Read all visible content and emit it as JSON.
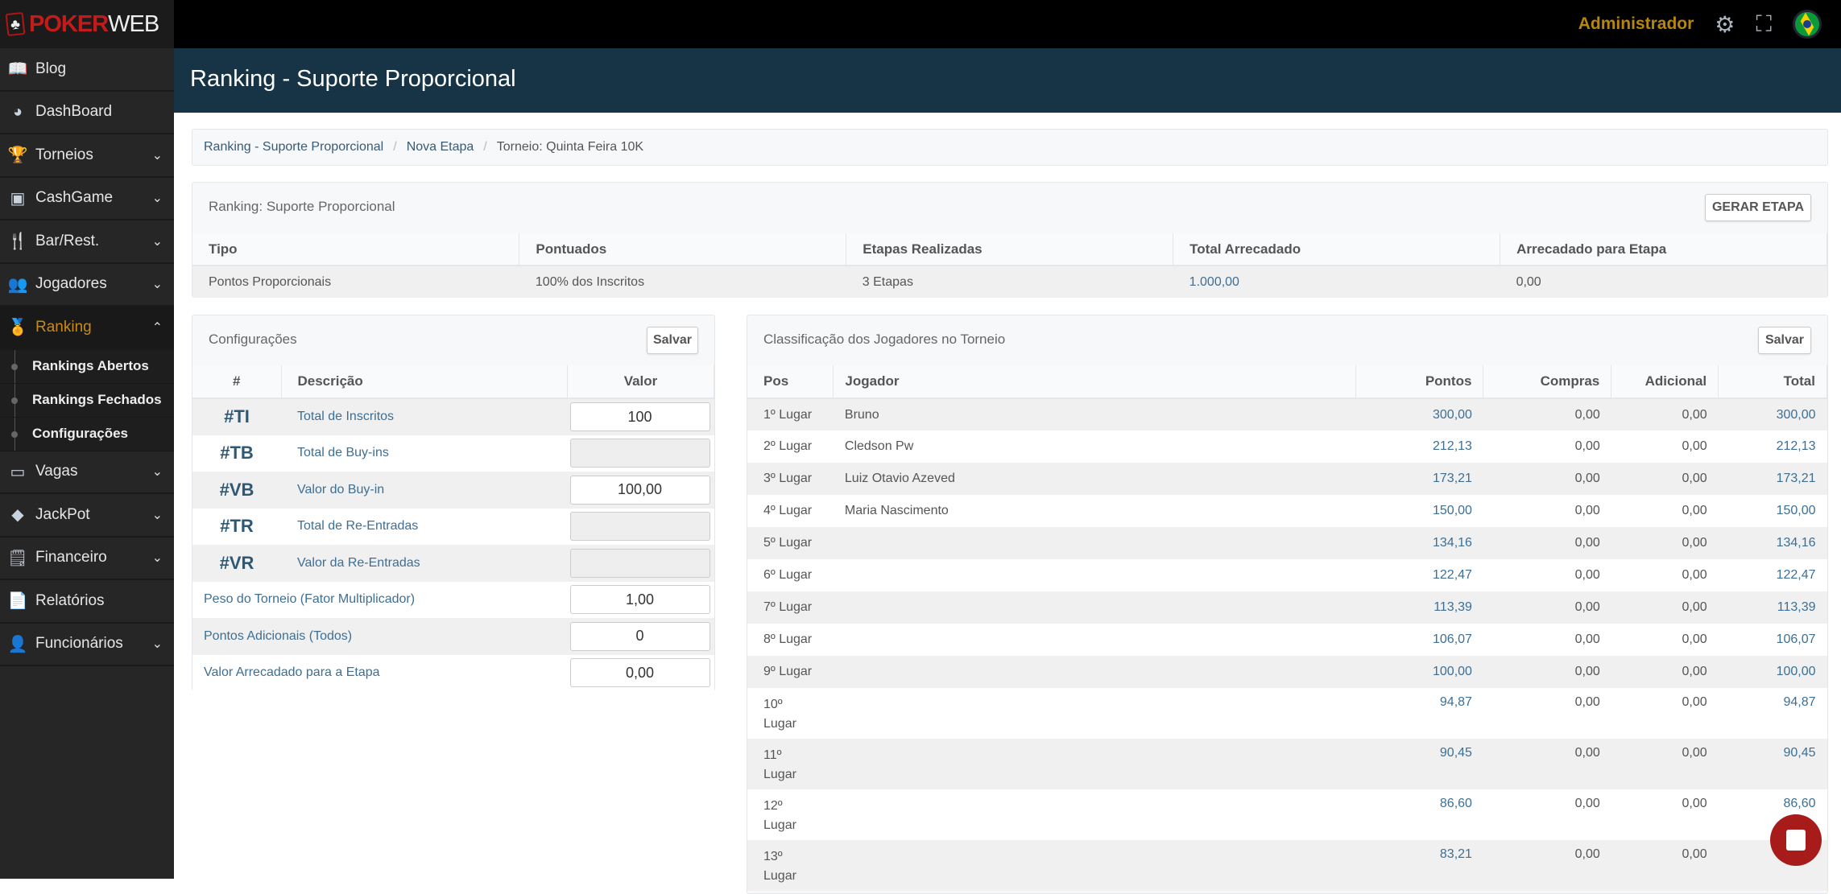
{
  "brand": {
    "part1": "POKER",
    "part2": "WEB"
  },
  "topbar": {
    "user": "Administrador",
    "icons": [
      "gears-icon",
      "fullscreen-icon",
      "brazil-flag-icon"
    ]
  },
  "sidebar": {
    "items": [
      {
        "label": "Blog",
        "icon": "book-icon",
        "expandable": false
      },
      {
        "label": "DashBoard",
        "icon": "pie-chart-icon",
        "expandable": false
      },
      {
        "label": "Torneios",
        "icon": "trophy-icon",
        "expandable": true
      },
      {
        "label": "CashGame",
        "icon": "money-icon",
        "expandable": true
      },
      {
        "label": "Bar/Rest.",
        "icon": "utensils-icon",
        "expandable": true
      },
      {
        "label": "Jogadores",
        "icon": "users-icon",
        "expandable": true
      },
      {
        "label": "Ranking",
        "icon": "medal-icon",
        "expandable": true,
        "active": true,
        "children": [
          "Rankings Abertos",
          "Rankings Fechados",
          "Configurações"
        ]
      },
      {
        "label": "Vagas",
        "icon": "ticket-icon",
        "expandable": true
      },
      {
        "label": "JackPot",
        "icon": "diamond-icon",
        "expandable": true
      },
      {
        "label": "Financeiro",
        "icon": "invoice-icon",
        "expandable": true
      },
      {
        "label": "Relatórios",
        "icon": "file-icon",
        "expandable": false
      },
      {
        "label": "Funcionários",
        "icon": "user-lock-icon",
        "expandable": true
      }
    ]
  },
  "page": {
    "title": "Ranking - Suporte Proporcional"
  },
  "breadcrumb": [
    "Ranking - Suporte Proporcional",
    "Nova Etapa",
    "Torneio: Quinta Feira 10K"
  ],
  "summary": {
    "title": "Ranking: Suporte Proporcional",
    "button": "GERAR ETAPA",
    "headers": [
      "Tipo",
      "Pontuados",
      "Etapas Realizadas",
      "Total Arrecadado",
      "Arrecadado para Etapa"
    ],
    "row": [
      "Pontos Proporcionais",
      "100% dos Inscritos",
      "3 Etapas",
      "1.000,00",
      "0,00"
    ]
  },
  "config": {
    "title": "Configurações",
    "button": "Salvar",
    "headers": [
      "#",
      "Descrição",
      "Valor"
    ],
    "rows": [
      {
        "code": "#TI",
        "label": "Total de Inscritos",
        "value": "100",
        "disabled": false
      },
      {
        "code": "#TB",
        "label": "Total de Buy-ins",
        "value": "",
        "disabled": true
      },
      {
        "code": "#VB",
        "label": "Valor do Buy-in",
        "value": "100,00",
        "disabled": false
      },
      {
        "code": "#TR",
        "label": "Total de Re-Entradas",
        "value": "",
        "disabled": true
      },
      {
        "code": "#VR",
        "label": "Valor da Re-Entradas",
        "value": "",
        "disabled": true
      },
      {
        "code": "",
        "label": "Peso do Torneio (Fator Multiplicador)",
        "value": "1,00",
        "disabled": false
      },
      {
        "code": "",
        "label": "Pontos Adicionais (Todos)",
        "value": "0",
        "disabled": false
      },
      {
        "code": "",
        "label": "Valor Arrecadado para a Etapa",
        "value": "0,00",
        "disabled": false
      }
    ]
  },
  "classification": {
    "title": "Classificação dos Jogadores no Torneio",
    "button": "Salvar",
    "headers": [
      "Pos",
      "Jogador",
      "Pontos",
      "Compras",
      "Adicional",
      "Total"
    ],
    "rows": [
      [
        "1º Lugar",
        "Bruno",
        "300,00",
        "0,00",
        "0,00",
        "300,00"
      ],
      [
        "2º Lugar",
        "Cledson Pw",
        "212,13",
        "0,00",
        "0,00",
        "212,13"
      ],
      [
        "3º Lugar",
        "Luiz Otavio Azeved",
        "173,21",
        "0,00",
        "0,00",
        "173,21"
      ],
      [
        "4º Lugar",
        "Maria Nascimento",
        "150,00",
        "0,00",
        "0,00",
        "150,00"
      ],
      [
        "5º Lugar",
        "",
        "134,16",
        "0,00",
        "0,00",
        "134,16"
      ],
      [
        "6º Lugar",
        "",
        "122,47",
        "0,00",
        "0,00",
        "122,47"
      ],
      [
        "7º Lugar",
        "",
        "113,39",
        "0,00",
        "0,00",
        "113,39"
      ],
      [
        "8º Lugar",
        "",
        "106,07",
        "0,00",
        "0,00",
        "106,07"
      ],
      [
        "9º Lugar",
        "",
        "100,00",
        "0,00",
        "0,00",
        "100,00"
      ],
      [
        "10º Lugar",
        "",
        "94,87",
        "0,00",
        "0,00",
        "94,87"
      ],
      [
        "11º Lugar",
        "",
        "90,45",
        "0,00",
        "0,00",
        "90,45"
      ],
      [
        "12º Lugar",
        "",
        "86,60",
        "0,00",
        "0,00",
        "86,60"
      ],
      [
        "13º Lugar",
        "",
        "83,21",
        "0,00",
        "0,00",
        ""
      ]
    ]
  },
  "chat": {
    "icon": "chat-icon",
    "color": "#a71b1b"
  }
}
